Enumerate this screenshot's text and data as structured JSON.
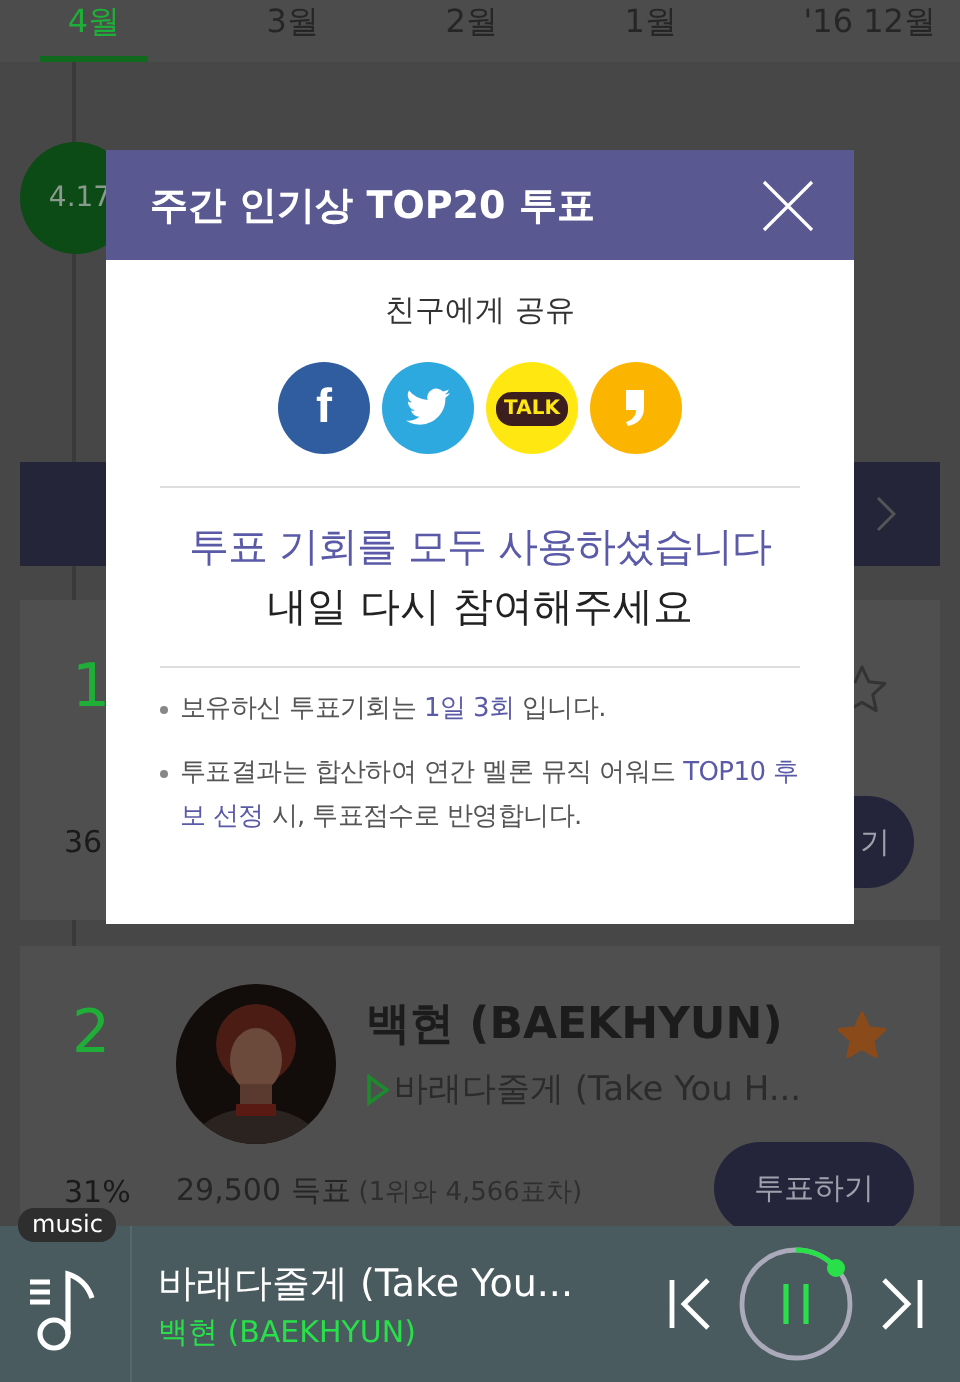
{
  "tabs": [
    {
      "label": "4월",
      "selected": true
    },
    {
      "label": "3월",
      "selected": false
    },
    {
      "label": "2월",
      "selected": false
    },
    {
      "label": "1월",
      "selected": false
    },
    {
      "label": "'16 12월",
      "selected": false
    }
  ],
  "timeline": {
    "date": "4.17"
  },
  "cards": [
    {
      "rank": "1",
      "starred": false,
      "percent": "36",
      "button": "기"
    },
    {
      "rank": "2",
      "starred": true,
      "artist": "백현 (BAEKHYUN)",
      "song": "바래다줄게 (Take You H...",
      "percent": "31%",
      "votes": "29,500 득표",
      "gap": "(1위와 4,566표차)",
      "button": "투표하기"
    }
  ],
  "player": {
    "badge": "music",
    "title": "바래다줄게 (Take You...",
    "artist": "백현 (BAEKHYUN)",
    "playing": true
  },
  "modal": {
    "title": "주간 인기상 TOP20 투표",
    "share_label": "친구에게 공유",
    "share_buttons": [
      {
        "kind": "facebook",
        "label": "f"
      },
      {
        "kind": "twitter"
      },
      {
        "kind": "kakaotalk",
        "label": "TALK"
      },
      {
        "kind": "kakaostory"
      }
    ],
    "message": "투표 기회를 모두 사용하셨습니다",
    "submessage": "내일 다시 참여해주세요",
    "notes": [
      {
        "parts": [
          {
            "text": "보유하신 투표기회는 ",
            "highlight": false
          },
          {
            "text": "1일 3회",
            "highlight": true
          },
          {
            "text": " 입니다.",
            "highlight": false
          }
        ]
      },
      {
        "parts": [
          {
            "text": "투표결과는 합산하여 연간 멜론 뮤직 어워드 ",
            "highlight": false
          },
          {
            "text": "TOP10 후보 선정",
            "highlight": true
          },
          {
            "text": " 시, 투표점수로 반영합니다.",
            "highlight": false
          }
        ]
      }
    ]
  }
}
